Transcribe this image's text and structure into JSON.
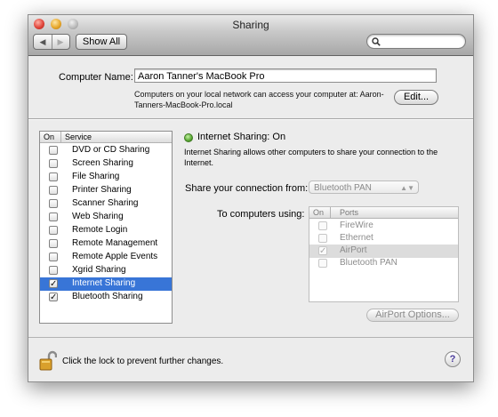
{
  "window": {
    "title": "Sharing"
  },
  "toolbar": {
    "back_glyph": "◀",
    "forward_glyph": "▶",
    "show_all_label": "Show All",
    "search_placeholder": "",
    "search_icon": "magnifier-icon"
  },
  "computer_name": {
    "label": "Computer Name:",
    "value": "Aaron Tanner's MacBook Pro",
    "note": "Computers on your local network can access your computer at: Aaron-Tanners-MacBook-Pro.local",
    "edit_label": "Edit..."
  },
  "services": {
    "header_on": "On",
    "header_service": "Service",
    "items": [
      {
        "label": "DVD or CD Sharing",
        "checked": false,
        "selected": false
      },
      {
        "label": "Screen Sharing",
        "checked": false,
        "selected": false
      },
      {
        "label": "File Sharing",
        "checked": false,
        "selected": false
      },
      {
        "label": "Printer Sharing",
        "checked": false,
        "selected": false
      },
      {
        "label": "Scanner Sharing",
        "checked": false,
        "selected": false
      },
      {
        "label": "Web Sharing",
        "checked": false,
        "selected": false
      },
      {
        "label": "Remote Login",
        "checked": false,
        "selected": false
      },
      {
        "label": "Remote Management",
        "checked": false,
        "selected": false
      },
      {
        "label": "Remote Apple Events",
        "checked": false,
        "selected": false
      },
      {
        "label": "Xgrid Sharing",
        "checked": false,
        "selected": false
      },
      {
        "label": "Internet Sharing",
        "checked": true,
        "selected": true
      },
      {
        "label": "Bluetooth Sharing",
        "checked": true,
        "selected": false
      }
    ]
  },
  "detail": {
    "status_title": "Internet Sharing: On",
    "status_color": "#5aa934",
    "description": "Internet Sharing allows other computers to share your connection to the Internet.",
    "share_from_label": "Share your connection from:",
    "share_from_value": "Bluetooth PAN",
    "to_computers_label": "To computers using:",
    "ports_header_on": "On",
    "ports_header_ports": "Ports",
    "ports": [
      {
        "label": "FireWire",
        "checked": false,
        "highlighted": false
      },
      {
        "label": "Ethernet",
        "checked": false,
        "highlighted": false
      },
      {
        "label": "AirPort",
        "checked": true,
        "highlighted": true
      },
      {
        "label": "Bluetooth PAN",
        "checked": false,
        "highlighted": false
      }
    ],
    "airport_options_label": "AirPort Options..."
  },
  "footer": {
    "lock_text": "Click the lock to prevent further changes.",
    "lock_icon": "padlock-open-icon",
    "help_glyph": "?"
  },
  "colors": {
    "selection": "#3875d7",
    "window_bg": "#ececec"
  }
}
